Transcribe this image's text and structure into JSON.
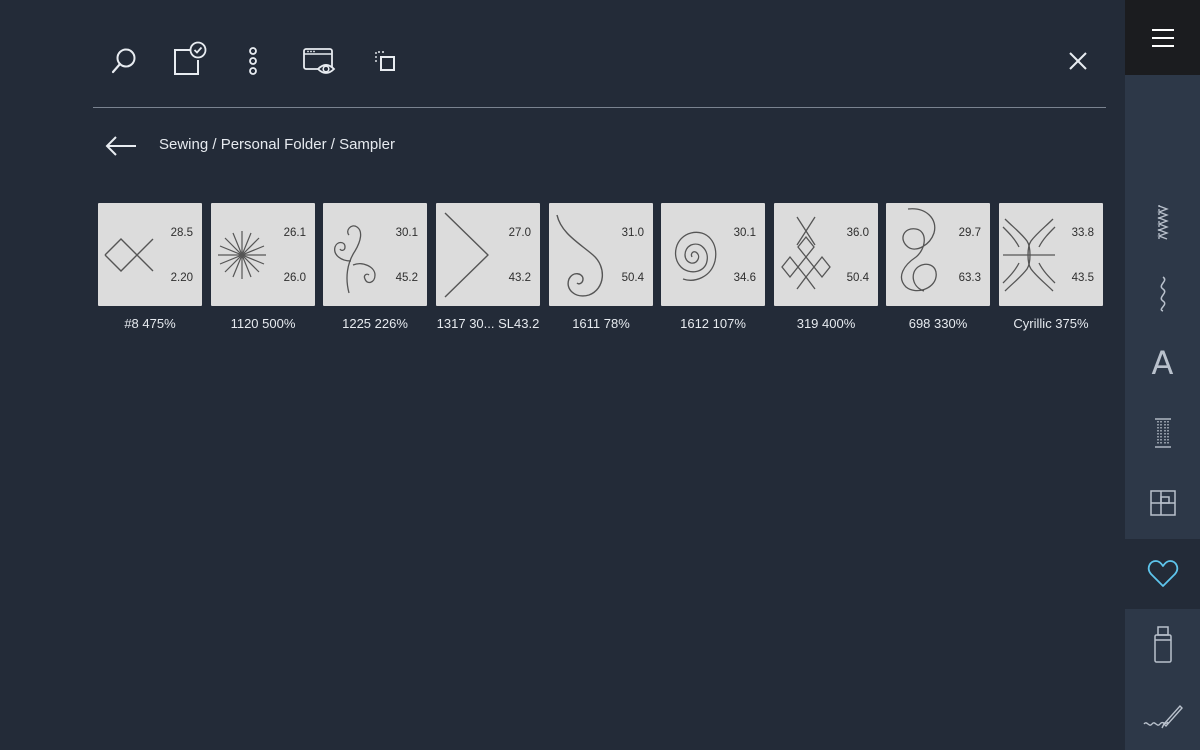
{
  "breadcrumb": "Sewing / Personal Folder / Sampler",
  "colors": {
    "accent": "#5ec5ec",
    "background": "#232b38",
    "sidebar": "#2d3848",
    "menu_bg": "#1b1c1f",
    "tile": "#dcdcdc"
  },
  "toolbar": {
    "icons": [
      "search-icon",
      "select-check-icon",
      "more-vertical-icon",
      "preview-eye-icon",
      "duplicate-icon",
      "close-icon"
    ]
  },
  "stitches": [
    {
      "id": "s1",
      "top": "28.5",
      "bottom": "2.20",
      "label": "#8 475%",
      "icon": "diamond-x-stitch-icon"
    },
    {
      "id": "s2",
      "top": "26.1",
      "bottom": "26.0",
      "label": "1120 500%",
      "icon": "star-burst-stitch-icon"
    },
    {
      "id": "s3",
      "top": "30.1",
      "bottom": "45.2",
      "label": "1225 226%",
      "icon": "curl-stitch-icon"
    },
    {
      "id": "s4",
      "top": "27.0",
      "bottom": "43.2",
      "label": "1317 30... SL43.2",
      "icon": "chevron-stitch-icon"
    },
    {
      "id": "s5",
      "top": "31.0",
      "bottom": "50.4",
      "label": "1611 78%",
      "icon": "spiral-hook-stitch-icon"
    },
    {
      "id": "s6",
      "top": "30.1",
      "bottom": "34.6",
      "label": "1612 107%",
      "icon": "spiral-stitch-icon"
    },
    {
      "id": "s7",
      "top": "36.0",
      "bottom": "50.4",
      "label": "319 400%",
      "icon": "diamond-lattice-stitch-icon"
    },
    {
      "id": "s8",
      "top": "29.7",
      "bottom": "63.3",
      "label": "698 330%",
      "icon": "loop-stitch-icon"
    },
    {
      "id": "s9",
      "top": "33.8",
      "bottom": "43.5",
      "label": "Cyrillic 375%",
      "icon": "cyrillic-stitch-icon"
    }
  ],
  "sidebar": {
    "items": [
      {
        "name": "menu-icon"
      },
      {
        "name": "utility-stitches-icon"
      },
      {
        "name": "decorative-stitches-icon"
      },
      {
        "name": "alphabet-icon",
        "text": "A"
      },
      {
        "name": "buttonhole-icon"
      },
      {
        "name": "quilt-block-icon"
      },
      {
        "name": "personal-menu-heart-icon",
        "active": true
      },
      {
        "name": "usb-stick-icon"
      },
      {
        "name": "sewing-techniques-icon"
      }
    ]
  }
}
